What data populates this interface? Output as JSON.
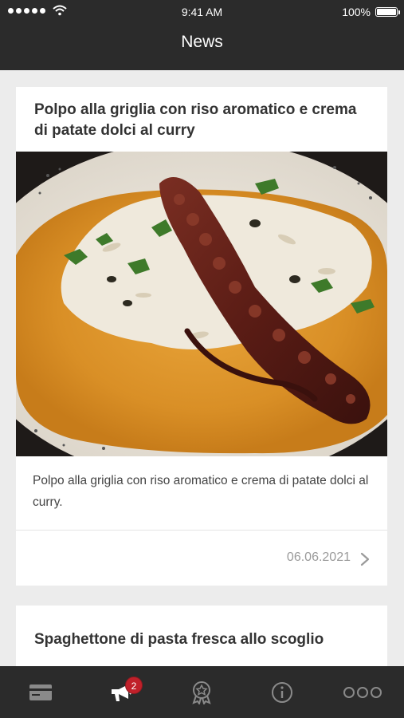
{
  "status_bar": {
    "time": "9:41 AM",
    "battery_percent": "100%",
    "signal_icon": "signal-dots-icon",
    "wifi_icon": "wifi-icon",
    "battery_icon": "battery-icon"
  },
  "nav": {
    "title": "News"
  },
  "news": [
    {
      "title": "Polpo alla griglia con riso aromatico e crema di patate dolci al curry",
      "image_description": "grilled-octopus-dish-photo",
      "description": "Polpo alla griglia con riso aromatico e crema di patate dolci al curry.",
      "date": "06.06.2021"
    },
    {
      "title": "Spaghettone di pasta fresca allo scoglio"
    }
  ],
  "tab_bar": {
    "tabs": [
      {
        "icon": "card-icon"
      },
      {
        "icon": "megaphone-icon",
        "badge": "2"
      },
      {
        "icon": "award-icon"
      },
      {
        "icon": "info-icon"
      },
      {
        "icon": "more-icon"
      }
    ]
  },
  "colors": {
    "bar_background": "#2b2b2b",
    "page_background": "#ececec",
    "badge": "#c0202a"
  }
}
